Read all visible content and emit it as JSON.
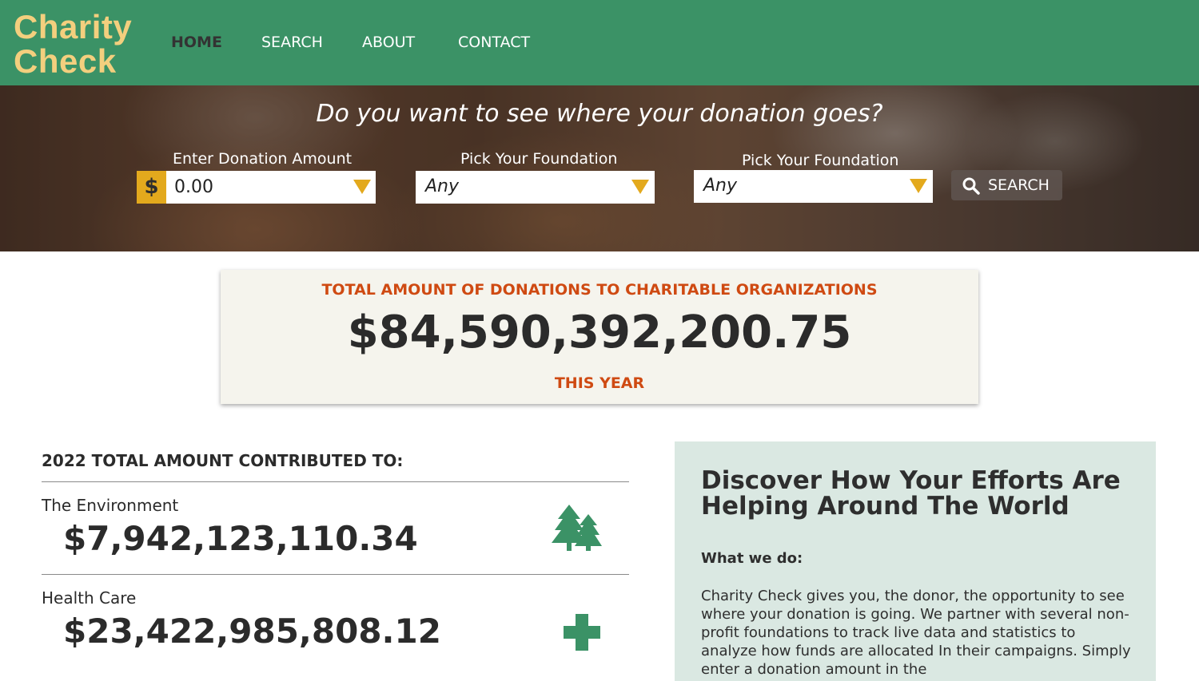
{
  "header": {
    "logo_line1": "Charity",
    "logo_line2": "Check",
    "nav": [
      {
        "label": "HOME"
      },
      {
        "label": "SEARCH"
      },
      {
        "label": "ABOUT"
      },
      {
        "label": "CONTACT"
      }
    ]
  },
  "hero": {
    "title": "Do you want to see where your donation goes?",
    "amount_label": "Enter Donation Amount",
    "currency_symbol": "$",
    "amount_value": "0.00",
    "foundation1_label": "Pick Your Foundation",
    "foundation1_value": "Any",
    "foundation2_label": "Pick Your Foundation",
    "foundation2_value": "Any",
    "search_button": "SEARCH"
  },
  "total": {
    "heading": "TOTAL AMOUNT OF DONATIONS TO CHARITABLE ORGANIZATIONS",
    "amount": "$84,590,392,200.75",
    "period": "THIS YEAR"
  },
  "contributions": {
    "heading": "2022 TOTAL AMOUNT CONTRIBUTED TO:",
    "items": [
      {
        "name": "The Environment",
        "amount": "$7,942,123,110.34",
        "icon": "trees-icon"
      },
      {
        "name": "Health Care",
        "amount": "$23,422,985,808.12",
        "icon": "medical-cross-icon"
      }
    ]
  },
  "info": {
    "title": "Discover How Your Efforts Are Helping Around The World",
    "subheading": "What we do:",
    "body": "Charity Check gives you, the donor, the opportunity to see where your donation is going. We partner with several non-profit foundations to track live data and statistics to analyze how funds are allocated In their campaigns. Simply enter a donation amount in the"
  },
  "colors": {
    "header_green": "#3b9266",
    "logo_gold": "#f3cf7e",
    "accent_yellow": "#e3a91d",
    "heading_orange": "#cf4a12",
    "icon_green": "#3b9266",
    "panel_mint": "#dae8e2"
  }
}
